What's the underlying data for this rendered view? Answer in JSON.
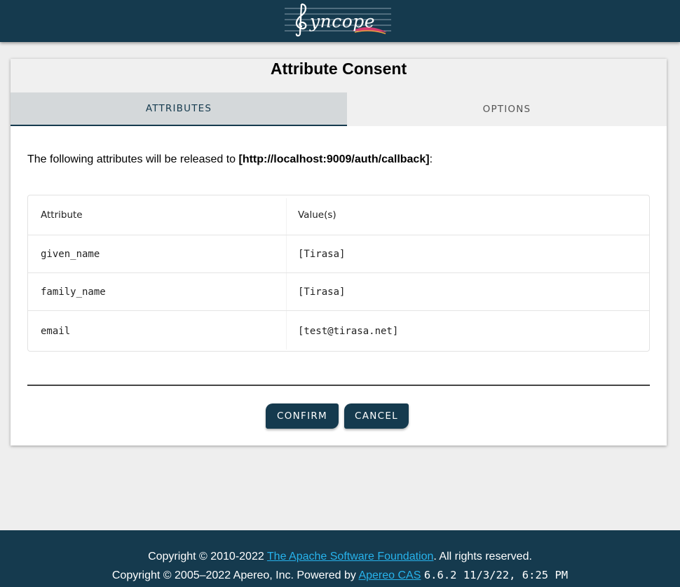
{
  "header": {
    "logo_text": "yncope",
    "logo_icon": "treble-clef-feather-logo"
  },
  "card": {
    "title": "Attribute Consent",
    "tabs": [
      {
        "label": "ATTRIBUTES",
        "active": true
      },
      {
        "label": "OPTIONS",
        "active": false
      }
    ],
    "intro_prefix": "The following attributes will be released to ",
    "service_url": "[http://localhost:9009/auth/callback]",
    "intro_suffix": ":",
    "table": {
      "headers": [
        "Attribute",
        "Value(s)"
      ],
      "rows": [
        [
          "given_name",
          "[Tirasa]"
        ],
        [
          "family_name",
          "[Tirasa]"
        ],
        [
          "email",
          "[test@tirasa.net]"
        ]
      ]
    },
    "buttons": {
      "confirm": "CONFIRM",
      "cancel": "CANCEL"
    }
  },
  "footer": {
    "line1_prefix": "Copyright © 2010-2022 ",
    "line1_link": "The Apache Software Foundation",
    "line1_suffix": ". All rights reserved.",
    "line2_prefix": "Copyright © 2005–2022 Apereo, Inc. Powered by ",
    "line2_link": "Apereo CAS",
    "version": "6.6.2 11/3/22, 6:25 PM"
  },
  "colors": {
    "brand": "#153a4e",
    "link": "#27b3ec",
    "background": "#eeeeee"
  }
}
